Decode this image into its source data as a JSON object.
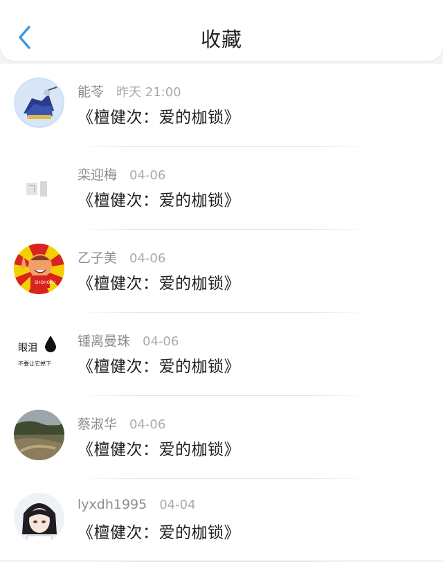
{
  "header": {
    "title": "收藏",
    "back_icon": "chevron-left-icon",
    "accent": "#3b9ae1"
  },
  "items": [
    {
      "name": "能苓",
      "time": "昨天 21:00",
      "content": "《檀健次：爱的枷锁》",
      "avatar": "avatar-cartoon-blue"
    },
    {
      "name": "栾迎梅",
      "time": "04-06",
      "content": "《檀健次：爱的枷锁》",
      "avatar": "avatar-faded-white"
    },
    {
      "name": "乙子美",
      "time": "04-06",
      "content": "《檀健次：爱的枷锁》",
      "avatar": "avatar-cartoon-basketball"
    },
    {
      "name": "锺离曼珠",
      "time": "04-06",
      "content": "《檀健次：爱的枷锁》",
      "avatar": "avatar-text",
      "avatar_text": {
        "line1": "眼泪",
        "line2": "不要让它掉下"
      }
    },
    {
      "name": "蔡淑华",
      "time": "04-06",
      "content": "《檀健次：爱的枷锁》",
      "avatar": "avatar-landscape"
    },
    {
      "name": "lyxdh1995",
      "time": "04-04",
      "content": "《檀健次：爱的枷锁》",
      "avatar": "avatar-anime-boy"
    }
  ]
}
